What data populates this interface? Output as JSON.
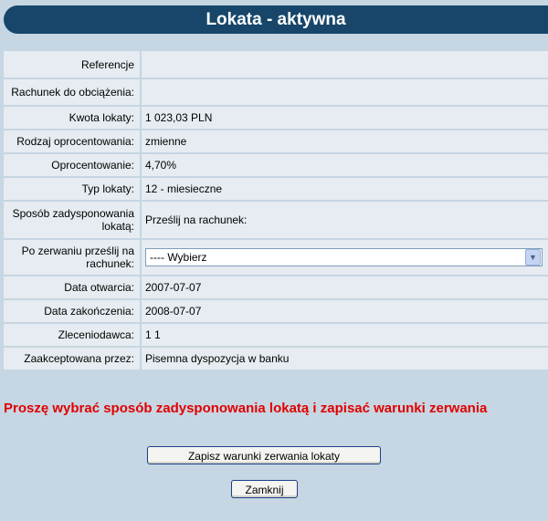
{
  "page": {
    "title": "Lokata - aktywna"
  },
  "details": [
    {
      "label": "Referencje",
      "value": ""
    },
    {
      "label": "Rachunek do obciążenia:",
      "value": ""
    },
    {
      "label": "Kwota lokaty:",
      "value": "1 023,03 PLN"
    },
    {
      "label": "Rodzaj oprocentowania:",
      "value": "zmienne"
    },
    {
      "label": "Oprocentowanie:",
      "value": "4,70%"
    },
    {
      "label": "Typ lokaty:",
      "value": "12 - miesieczne"
    },
    {
      "label": "Sposób zadysponowania lokatą:",
      "value": "Prześlij na rachunek:"
    },
    {
      "label": "Po zerwaniu prześlij na rachunek:",
      "value": ""
    },
    {
      "label": "Data otwarcia:",
      "value": "2007-07-07"
    },
    {
      "label": "Data zakończenia:",
      "value": "2008-07-07"
    },
    {
      "label": "Zleceniodawca:",
      "value": "1 1"
    },
    {
      "label": "Zaakceptowana przez:",
      "value": "Pisemna dyspozycja w banku"
    }
  ],
  "select": {
    "selected": "---- Wybierz",
    "icon": "chevron-down-icon"
  },
  "warning": "Proszę wybrać sposób zadysponowania lokatą i zapisać warunki zerwania",
  "buttons": {
    "save_label": "Zapisz warunki zerwania lokaty",
    "close_label": "Zamknij"
  },
  "colors": {
    "background": "#c6d6e2",
    "title_bar": "#17466a",
    "row": "#e6ecf1",
    "warning": "#e00000"
  }
}
